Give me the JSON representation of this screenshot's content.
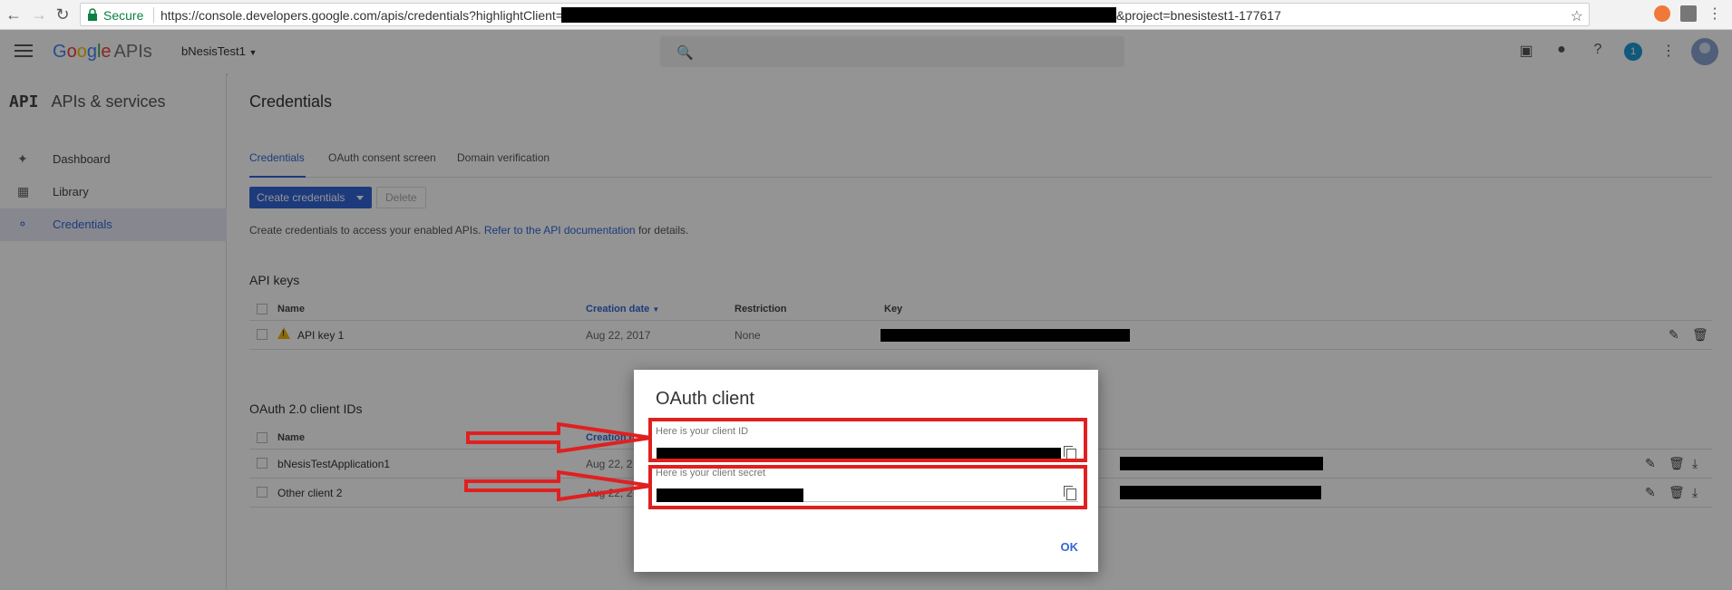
{
  "browser": {
    "secure_label": "Secure",
    "url_prefix": "https://console.developers.google.com/apis/credentials?highlightClient=",
    "url_suffix": "&project=bnesistest1-177617"
  },
  "header": {
    "logo_g": "G",
    "logo_o1": "o",
    "logo_o2": "o",
    "logo_g2": "g",
    "logo_l": "l",
    "logo_e": "e",
    "logo_apis": "APIs",
    "project": "bNesisTest1",
    "notifications_count": "1"
  },
  "sidebar": {
    "title_icon": "API",
    "title": "APIs & services",
    "items": [
      {
        "label": "Dashboard",
        "icon": "dashboard-icon"
      },
      {
        "label": "Library",
        "icon": "library-icon"
      },
      {
        "label": "Credentials",
        "icon": "key-icon"
      }
    ]
  },
  "main": {
    "title": "Credentials",
    "tabs": [
      "Credentials",
      "OAuth consent screen",
      "Domain verification"
    ],
    "create_label": "Create credentials",
    "delete_label": "Delete",
    "intro_text": "Create credentials to access your enabled APIs.",
    "intro_link": "Refer to the API documentation",
    "intro_suffix": "for details.",
    "api_keys": {
      "title": "API keys",
      "headers": {
        "name": "Name",
        "created": "Creation date",
        "restriction": "Restriction",
        "key": "Key"
      },
      "rows": [
        {
          "name": "API key 1",
          "created": "Aug 22, 2017",
          "restriction": "None"
        }
      ]
    },
    "oauth": {
      "title": "OAuth 2.0 client IDs",
      "headers": {
        "name": "Name",
        "created": "Creation date"
      },
      "rows": [
        {
          "name": "bNesisTestApplication1",
          "created": "Aug 22, 2"
        },
        {
          "name": "Other client 2",
          "created": "Aug 22, 2"
        }
      ]
    }
  },
  "dialog": {
    "title": "OAuth client",
    "client_id_label": "Here is your client ID",
    "client_secret_label": "Here is your client secret",
    "ok_label": "OK"
  },
  "colors": {
    "accent": "#3367d6",
    "annotation": "#e02020"
  }
}
